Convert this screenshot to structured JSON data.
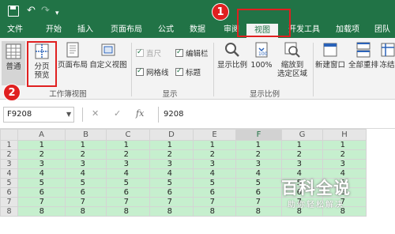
{
  "titlebar": {
    "save_icon": "save-icon",
    "undo_icon": "undo-icon",
    "redo_icon": "redo-icon"
  },
  "tabs": [
    {
      "label": "文件"
    },
    {
      "label": "开始"
    },
    {
      "label": "插入"
    },
    {
      "label": "页面布局"
    },
    {
      "label": "公式"
    },
    {
      "label": "数据"
    },
    {
      "label": "审阅"
    },
    {
      "label": "视图",
      "active": true
    },
    {
      "label": "开发工具"
    },
    {
      "label": "加载项"
    },
    {
      "label": "团队"
    }
  ],
  "ribbon": {
    "workbook_views": {
      "normal": "普通",
      "page_break_preview_1": "分页",
      "page_break_preview_2": "预览",
      "page_layout": "页面布局",
      "custom_views": "自定义视图",
      "group_label": "工作簿视图"
    },
    "show": {
      "ruler": "直尺",
      "gridlines": "网格线",
      "formula_bar": "编辑栏",
      "headings": "标题",
      "group_label": "显示"
    },
    "zoom": {
      "zoom": "显示比例",
      "zoom_100": "100%",
      "zoom_selection_1": "缩放到",
      "zoom_selection_2": "选定区域",
      "group_label": "显示比例"
    },
    "window": {
      "new_window": "新建窗口",
      "arrange_all": "全部重排",
      "freeze": "冻结"
    }
  },
  "formula_bar": {
    "name_box": "F9208",
    "cancel_icon": "✕",
    "enter_icon": "✓",
    "fx": "fx",
    "value": "9208"
  },
  "grid": {
    "columns": [
      "A",
      "B",
      "C",
      "D",
      "E",
      "F",
      "G",
      "H"
    ],
    "selected_column": "F",
    "rows": [
      {
        "num": "1",
        "cells": [
          "1",
          "1",
          "1",
          "1",
          "1",
          "1",
          "1",
          "1"
        ]
      },
      {
        "num": "2",
        "cells": [
          "2",
          "2",
          "2",
          "2",
          "2",
          "2",
          "2",
          "2"
        ]
      },
      {
        "num": "3",
        "cells": [
          "3",
          "3",
          "3",
          "3",
          "3",
          "3",
          "3",
          "3"
        ]
      },
      {
        "num": "4",
        "cells": [
          "4",
          "4",
          "4",
          "4",
          "4",
          "4",
          "4",
          "4"
        ]
      },
      {
        "num": "5",
        "cells": [
          "5",
          "5",
          "5",
          "5",
          "5",
          "5",
          "5",
          "5"
        ]
      },
      {
        "num": "6",
        "cells": [
          "6",
          "6",
          "6",
          "6",
          "6",
          "6",
          "6",
          "6"
        ]
      },
      {
        "num": "7",
        "cells": [
          "7",
          "7",
          "7",
          "7",
          "7",
          "7",
          "7",
          "7"
        ]
      },
      {
        "num": "8",
        "cells": [
          "8",
          "8",
          "8",
          "8",
          "8",
          "8",
          "8",
          "8"
        ]
      }
    ]
  },
  "annotations": {
    "badge_1": "1",
    "badge_2": "2"
  },
  "watermark": {
    "title": "百科全说",
    "subtitle": "助你轻松解决"
  },
  "colors": {
    "excel_green": "#217346",
    "cell_fill": "#c6efce",
    "annotation_red": "#e02020"
  }
}
